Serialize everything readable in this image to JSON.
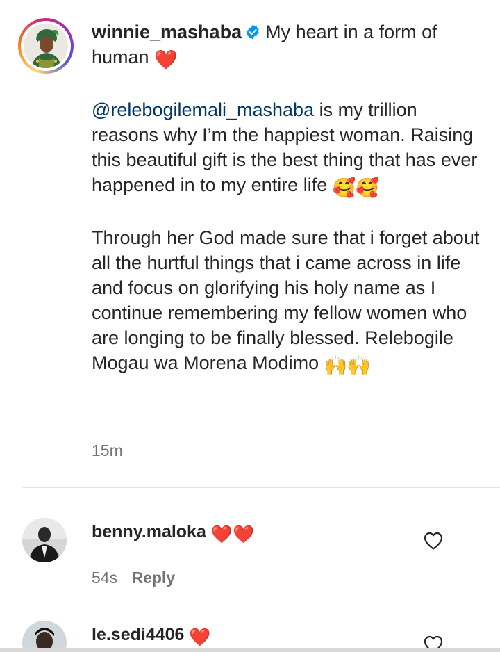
{
  "caption": {
    "username": "winnie_mashaba",
    "title_text": "My heart in a form of human",
    "mention": "@relebogilemali_mashaba",
    "para1_rest": " is my trillion reasons why I’m the happiest woman. Raising this beautiful gift is the best thing that has ever happened in to my entire life",
    "para2": "Through her God made sure that i forget about all the hurtful things that i came across in life and focus on glorifying his holy name as I continue remembering my fellow women who are longing to be finally blessed. Relebogile Mogau wa Morena Modimo",
    "timestamp": "15m",
    "emoji": {
      "heart": "❤️",
      "smiling_hearts": "🥰🥰",
      "raised_hands": "🙌🙌"
    }
  },
  "comments": [
    {
      "username": "benny.maloka",
      "text": "❤️❤️",
      "time": "54s",
      "reply_label": "Reply"
    },
    {
      "username": "le.sedi4406",
      "text": "❤️"
    }
  ],
  "icons": {
    "verified": "verified-badge-icon",
    "like": "heart-outline-icon"
  },
  "colors": {
    "text": "#262626",
    "secondary": "#737373",
    "mention": "#00376b",
    "verified": "#0095f6",
    "heart": "#ed1c24"
  }
}
